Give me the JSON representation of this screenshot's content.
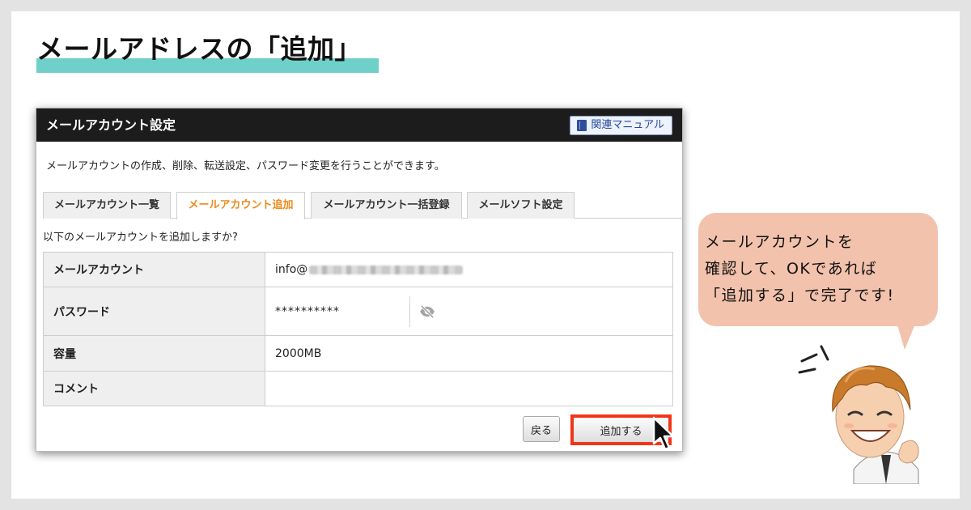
{
  "heading": "メールアドレスの「追加」",
  "panel": {
    "title": "メールアカウント設定",
    "manual_button": "関連マニュアル",
    "description": "メールアカウントの作成、削除、転送設定、パスワード変更を行うことができます。",
    "tabs": [
      {
        "label": "メールアカウント一覧",
        "active": false
      },
      {
        "label": "メールアカウント追加",
        "active": true
      },
      {
        "label": "メールアカウント一括登録",
        "active": false
      },
      {
        "label": "メールソフト設定",
        "active": false
      }
    ],
    "confirm_text": "以下のメールアカウントを追加しますか?",
    "rows": {
      "account": {
        "label": "メールアカウント",
        "value": "info@"
      },
      "password": {
        "label": "パスワード",
        "value": "**********"
      },
      "capacity": {
        "label": "容量",
        "value": "2000MB"
      },
      "comment": {
        "label": "コメント",
        "value": ""
      }
    },
    "back_button": "戻る",
    "add_button": "追加する"
  },
  "bubble": {
    "line1": "メールアカウントを",
    "line2": "確認して、OKであれば",
    "line3": "「追加する」で完了です!"
  },
  "colors": {
    "accent_underline": "#6fd0c9",
    "active_tab": "#ee8a1c",
    "highlight_border": "#f0351a",
    "bubble": "#f2c2ac",
    "header_bg": "#1c1c1c"
  },
  "icons": [
    "book-icon",
    "eye-slash-icon",
    "mouse-pointer-icon"
  ]
}
